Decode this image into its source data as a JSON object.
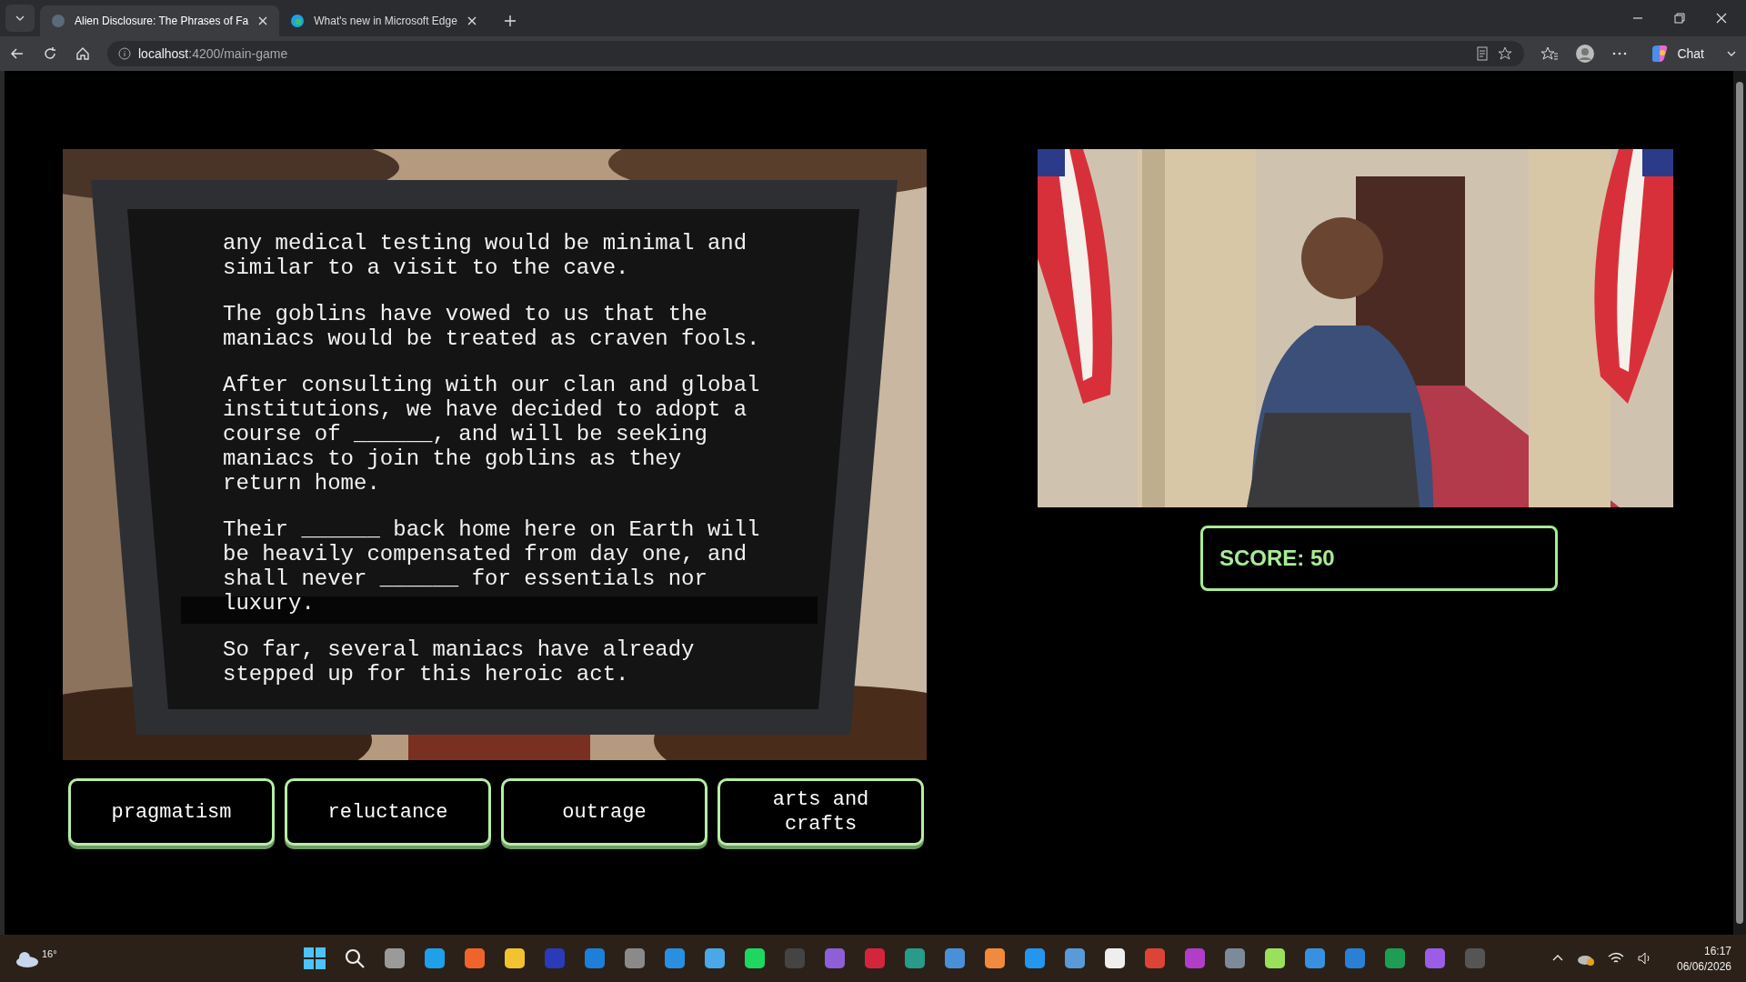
{
  "browser": {
    "tabs": [
      {
        "title": "Alien Disclosure: The Phrases of Fa",
        "selected": true
      },
      {
        "title": "What's new in Microsoft Edge",
        "selected": false
      }
    ],
    "address": {
      "host": "localhost",
      "path": ":4200/main-game"
    },
    "chat_label": "Chat"
  },
  "game": {
    "passage": [
      "any medical testing would be minimal and similar to a visit to the cave.",
      "The goblins have vowed to us that the maniacs would be treated as craven fools.",
      "After consulting with our clan and global institutions, we have decided to adopt a course of ______, and will be seeking maniacs to join the goblins as they return home.",
      "Their ______ back home here on Earth will be heavily compensated from day one, and shall never ______ for essentials nor luxury.",
      "So far, several maniacs have already stepped up for this heroic act."
    ],
    "choices": [
      "pragmatism",
      "reluctance",
      "outrage",
      "arts and crafts"
    ],
    "score": "SCORE: 50"
  },
  "taskbar": {
    "weather": "16°",
    "time": "16:17",
    "date": "06/06/2026"
  }
}
